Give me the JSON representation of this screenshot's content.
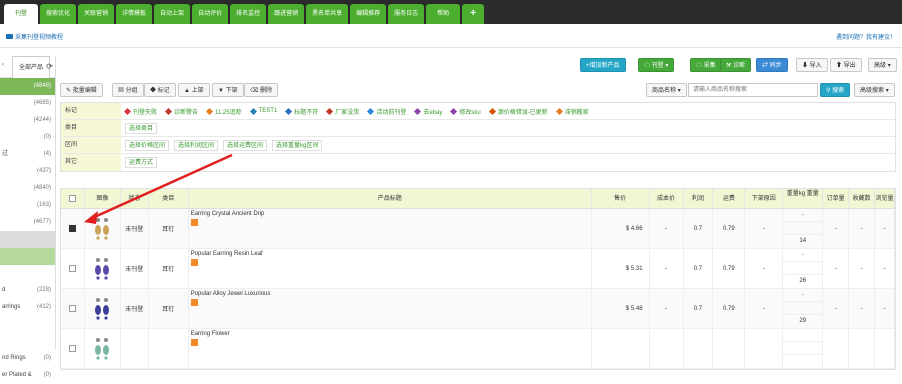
{
  "tabs": [
    "刊登",
    "搜索优化",
    "关联营销",
    "详情模板",
    "自动上架",
    "自动评价",
    "排名监控",
    "跟进营销",
    "黑名单共享",
    "编辑推荐",
    "服务日志",
    "帮助",
    "+"
  ],
  "subbar": {
    "tutorial": "采集刊登视频教程",
    "feedback": "遇到问题？我有建议！"
  },
  "left": {
    "tab": "全部产品",
    "rows": [
      {
        "label": "",
        "count": "(4848)",
        "style": "sel"
      },
      {
        "label": "",
        "count": "(4685)",
        "style": ""
      },
      {
        "label": "",
        "count": "(4244)",
        "style": ""
      },
      {
        "label": "",
        "count": "(0)",
        "style": ""
      },
      {
        "label": "过",
        "count": "(4)",
        "style": ""
      },
      {
        "label": "",
        "count": "(437)",
        "style": ""
      },
      {
        "label": "",
        "count": "(4840)",
        "style": ""
      },
      {
        "label": "",
        "count": "(163)",
        "style": ""
      },
      {
        "label": "",
        "count": "(4677)",
        "style": ""
      },
      {
        "label": "",
        "count": "",
        "style": "grey"
      },
      {
        "label": "",
        "count": "",
        "style": "green"
      },
      {
        "label": "",
        "count": "",
        "style": ""
      },
      {
        "label": "d",
        "count": "(228)",
        "style": ""
      },
      {
        "label": "arrings",
        "count": "(412)",
        "style": ""
      },
      {
        "label": "",
        "count": "",
        "style": ""
      },
      {
        "label": "",
        "count": "",
        "style": ""
      },
      {
        "label": "nd Rings",
        "count": "(0)",
        "style": ""
      },
      {
        "label": "er Plated &",
        "count": "(0)",
        "style": ""
      }
    ]
  },
  "toolbar": {
    "add": "+增加新产品",
    "publish": "刊登",
    "collect": "采集",
    "diagnose": "诊断",
    "sync": "同步",
    "import": "导入",
    "export": "导出",
    "advanced": "高级"
  },
  "toolbar2": {
    "batch_edit": "批量编辑",
    "group": "分组",
    "mark": "标记",
    "up": "上架",
    "down": "下架",
    "delete": "删除",
    "field_select": "商品名称",
    "search_placeholder": "请输入商品名称搜索",
    "search_btn": "搜索",
    "adv_search": "高级搜索"
  },
  "filters": {
    "labels": [
      "标记",
      "类目",
      "区间",
      "其它"
    ],
    "tags": [
      {
        "text": "刊登失败",
        "color": "#d9363e"
      },
      {
        "text": "诊断警告",
        "color": "#c0392b"
      },
      {
        "text": "11.25追踪",
        "color": "#e67e22"
      },
      {
        "text": "TEST1",
        "color": "#2980b9"
      },
      {
        "text": "标题不符",
        "color": "#2c6fbb"
      },
      {
        "text": "厂家没货",
        "color": "#c0392b"
      },
      {
        "text": "活动前刊登",
        "color": "#2e86de"
      },
      {
        "text": "去ebay",
        "color": "#8e44ad"
      },
      {
        "text": "修改sku",
        "color": "#8e44ad"
      },
      {
        "text": "源价格错误-已更新",
        "color": "#d35400"
      },
      {
        "text": "滞销搬家",
        "color": "#e67e22"
      }
    ],
    "category": [
      "选择类目"
    ],
    "ranges": [
      "选择价格区间",
      "选择利润区间",
      "选择运费区间",
      "选择重量kg区间"
    ],
    "other": [
      "运费方式"
    ]
  },
  "table": {
    "headers": [
      "",
      "图像",
      "状态",
      "类目",
      "产品标题",
      "售价",
      "成本价",
      "利润",
      "运费",
      "下架原因",
      "重量kg 重量",
      "订单量",
      "收藏数",
      "浏览量"
    ],
    "rows": [
      {
        "checked": true,
        "status": "未刊登",
        "category": "耳钉",
        "title": "Earring Crystal Ancient Drip",
        "price": "$ 4.66",
        "cost": "-",
        "profit": "0.7",
        "freight": "0.79",
        "reason": "-",
        "weight_top": "-",
        "weight_bottom": "14",
        "orders": "-",
        "fav": "-",
        "views": "-"
      },
      {
        "checked": false,
        "status": "未刊登",
        "category": "耳钉",
        "title": "Popular Earring Resin Leaf",
        "price": "$ 5.31",
        "cost": "-",
        "profit": "0.7",
        "freight": "0.79",
        "reason": "-",
        "weight_top": "-",
        "weight_bottom": "26",
        "orders": "-",
        "fav": "-",
        "views": "-"
      },
      {
        "checked": false,
        "status": "未刊登",
        "category": "耳钉",
        "title": "Popular Alloy Jewel Luxurious",
        "price": "$ 5.48",
        "cost": "-",
        "profit": "0.7",
        "freight": "0.79",
        "reason": "-",
        "weight_top": "-",
        "weight_bottom": "29",
        "orders": "-",
        "fav": "-",
        "views": "-"
      },
      {
        "checked": false,
        "status": "",
        "category": "",
        "title": "Earring Flower",
        "price": "",
        "cost": "",
        "profit": "",
        "freight": "",
        "reason": "",
        "weight_top": "",
        "weight_bottom": "",
        "orders": "",
        "fav": "",
        "views": ""
      }
    ]
  }
}
